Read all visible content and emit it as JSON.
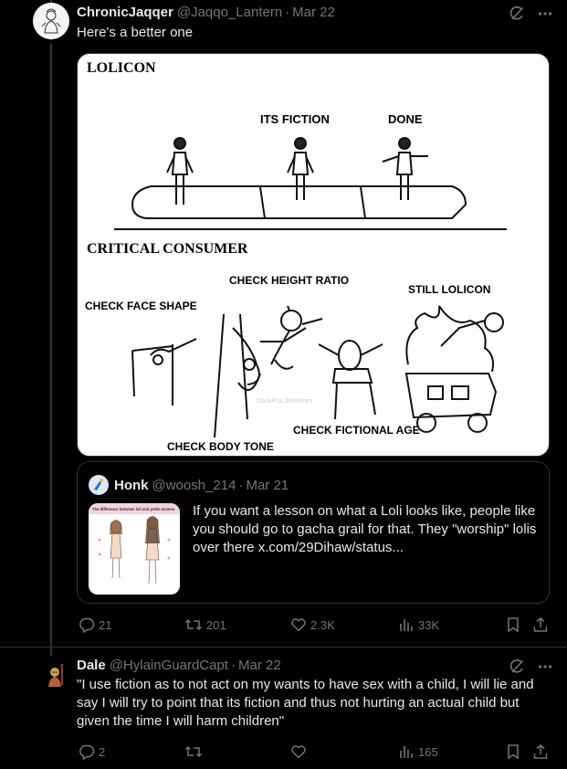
{
  "tweet1": {
    "name": "ChronicJaqqer",
    "handle": "@Jaqqo_Lantern",
    "sep": "·",
    "time": "Mar 22",
    "text": "Here's a better one",
    "image": {
      "top_label": "LOLICON",
      "top_labels": [
        "ITS FICTION",
        "DONE"
      ],
      "bottom_label": "CRITICAL CONSUMER",
      "panel_labels": [
        "CHECK FACE SHAPE",
        "CHECK HEIGHT RATIO",
        "STILL LOLICON",
        "CHECK FICTIONAL AGE",
        "CHECK BODY TONE"
      ],
      "watermark": "DankProLifeMemes"
    },
    "quote": {
      "name": "Honk",
      "handle": "@woosh_214",
      "sep": "·",
      "time": "Mar 21",
      "thumb_title": "The difference between loli and petite women",
      "text": "If you want a lesson on what a Loli looks like, people like you should go to gacha grail for that. They \"worship\" lolis over there  x.com/29Dihaw/status..."
    },
    "stats": {
      "replies": "21",
      "reposts": "201",
      "likes": "2.3K",
      "views": "33K"
    }
  },
  "tweet2": {
    "name": "Dale",
    "handle": "@HylainGuardCapt",
    "sep": "·",
    "time": "Mar 22",
    "text": "\"I use fiction as to not act on my wants to have sex with a child, I will lie and say I will try to point that its fiction and thus not hurting an actual child but given the time I will harm children\"",
    "stats": {
      "replies": "2",
      "reposts": "",
      "likes": "",
      "views": "165"
    }
  },
  "colors": {
    "background": "#000000",
    "text": "#e7e9ea",
    "muted": "#71767b",
    "border": "#2f3336",
    "accent": "#1d9bf0"
  },
  "icons": [
    "grok-slash-icon",
    "more-icon",
    "reply-icon",
    "repost-icon",
    "like-icon",
    "views-icon",
    "bookmark-icon",
    "share-icon"
  ]
}
